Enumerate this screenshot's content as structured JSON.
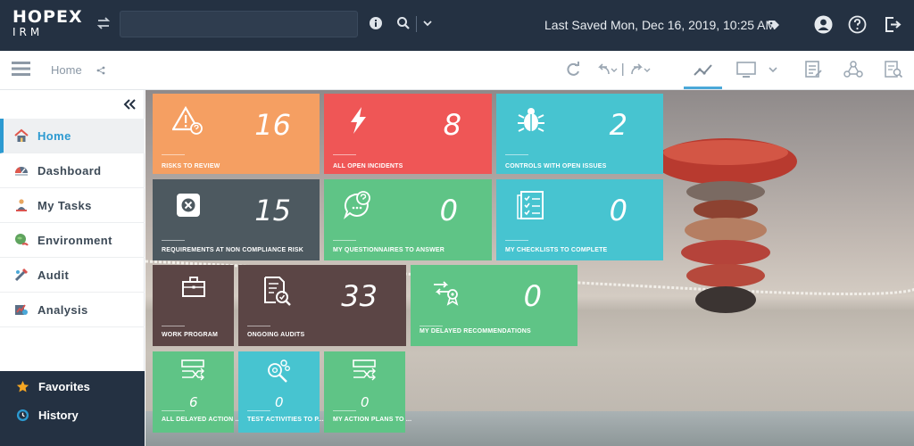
{
  "app": {
    "logo_line1": "HOPEX",
    "logo_line2": "IRM",
    "last_saved": "Last Saved Mon, Dec 16, 2019, 10:25 AM",
    "search_placeholder": ""
  },
  "subbar": {
    "breadcrumb": "Home"
  },
  "sidebar": {
    "items": [
      {
        "label": "Home",
        "icon": "home-icon",
        "active": true
      },
      {
        "label": "Dashboard",
        "icon": "dashboard-icon"
      },
      {
        "label": "My Tasks",
        "icon": "tasks-icon"
      },
      {
        "label": "Environment",
        "icon": "environment-icon"
      },
      {
        "label": "Audit",
        "icon": "audit-icon"
      },
      {
        "label": "Analysis",
        "icon": "analysis-icon"
      }
    ],
    "bottom": [
      {
        "label": "Favorites",
        "icon": "star-icon"
      },
      {
        "label": "History",
        "icon": "history-icon"
      }
    ]
  },
  "tiles": [
    {
      "label": "Risks to review",
      "value": "16",
      "icon": "risk-warning-icon",
      "color": "#f59f62"
    },
    {
      "label": "All open incidents",
      "value": "8",
      "icon": "lightning-icon",
      "color": "#ef5656"
    },
    {
      "label": "Controls with open issues",
      "value": "2",
      "icon": "bug-icon",
      "color": "#47c4d0"
    },
    {
      "label": "Requirements at non compliance risk",
      "value": "15",
      "icon": "close-box-icon",
      "color": "#4d5960"
    },
    {
      "label": "My questionnaires to answer",
      "value": "0",
      "icon": "question-bubble-icon",
      "color": "#5fc486"
    },
    {
      "label": "My checklists to complete",
      "value": "0",
      "icon": "checklist-icon",
      "color": "#47c4d0"
    },
    {
      "label": "Work program",
      "value": "",
      "icon": "briefcase-icon",
      "color": "#5b4545"
    },
    {
      "label": "Ongoing audits",
      "value": "33",
      "icon": "audit-doc-icon",
      "color": "#5b4545"
    },
    {
      "label": "My delayed recommendations",
      "value": "0",
      "icon": "recommendation-icon",
      "color": "#5fc486"
    },
    {
      "label": "All delayed action ...",
      "value": "6",
      "icon": "action-plan-icon",
      "color": "#5fc486"
    },
    {
      "label": "Test activities to p...",
      "value": "0",
      "icon": "test-activity-icon",
      "color": "#47c4d0"
    },
    {
      "label": "My action plans to ...",
      "value": "0",
      "icon": "action-plan-icon",
      "color": "#5fc486"
    }
  ]
}
